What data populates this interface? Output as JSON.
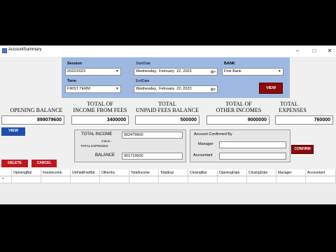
{
  "window": {
    "title": "AccountSummary"
  },
  "filters": {
    "session_label": "Session",
    "session_value": "2022/2023",
    "term_label": "Term",
    "term_value": "FIRST TERM",
    "start_label": "StartDate",
    "start_weekday": "Wednesday,",
    "start_month": "February",
    "start_day": "22, 2023",
    "end_label": "EndDate",
    "end_weekday": "Wednesday,",
    "end_month": "February",
    "end_day": "22, 2023",
    "bank_label": "BANK",
    "bank_value": "First Bank",
    "view_label": "VIEW"
  },
  "summary": {
    "opening_balance_label": "OPENING BALANCE",
    "opening_balance_value": "899079600",
    "income_fees_label_1": "TOTAL OF",
    "income_fees_label_2": "INCOME FROM FEES",
    "income_fees_value": "3400000",
    "unpaid_fees_label_1": "TOTAL",
    "unpaid_fees_label_2": "UNPAID FEES BALANCE",
    "unpaid_fees_value": "500000",
    "other_incomes_label_1": "TOTAL OF",
    "other_incomes_label_2": "OTHER INCOMES",
    "other_incomes_value": "9000000",
    "expenses_label_1": "TOTAL",
    "expenses_label_2": "EXPENSES",
    "expenses_value": "760000"
  },
  "actions": {
    "view_label": "VIEW",
    "delete_label": "DELETE",
    "cancel_label": "CANCEL"
  },
  "calc": {
    "total_income_label": "TOTAL INCOME",
    "total_income_value": "902479600",
    "minus_label": "minus -",
    "total_expenses_label": "TOTAL EXPENSES",
    "balance_label": "BALANCE",
    "balance_value": "901719600"
  },
  "confirm": {
    "title": "Account Confirmed By",
    "manager_label": "Manager",
    "accountant_label": "Accountant",
    "confirm_label": "CONFIRM"
  },
  "grid": {
    "columns": [
      "OpeningBal",
      "FeesIncome",
      "UnPaidFeeBal",
      "OtherInc.",
      "TotalIncome",
      "TotalExp",
      "ClosingBal",
      "OpeningDate",
      "ClosingDate",
      "Manager",
      "Accountant"
    ],
    "row_marker": "*"
  }
}
